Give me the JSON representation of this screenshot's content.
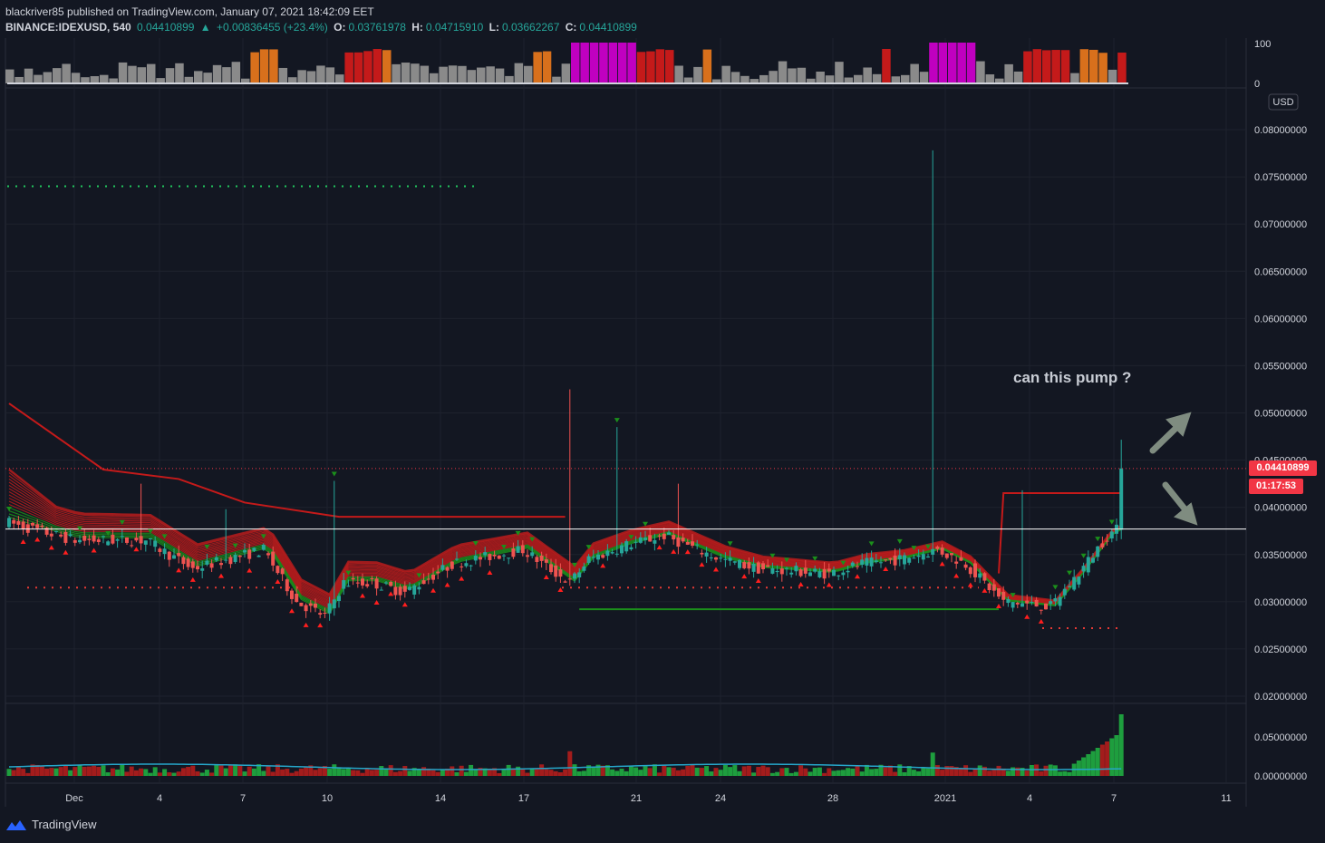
{
  "header": {
    "publisher": "blackriver85 published on TradingView.com, January 07, 2021 18:42:09 EET",
    "symbol": "BINANCE:IDEXUSD, 540",
    "last": "0.04410899",
    "change": "+0.00836455 (+23.4%)",
    "o_label": "O:",
    "o": "0.03761978",
    "h_label": "H:",
    "h": "0.04715910",
    "l_label": "L:",
    "l": "0.03662267",
    "c_label": "C:",
    "c": "0.04410899"
  },
  "price_tag": "0.04410899",
  "countdown": "01:17:53",
  "currency": "USD",
  "annotation": "can this pump ?",
  "footer_brand": "TradingView",
  "colors": {
    "background": "#131722",
    "up": "#26a69a",
    "down": "#ef5350",
    "ribbon_red": "#b71c1c",
    "ribbon_green": "#1b8f1b",
    "magenta": "#c000c0",
    "orange": "#d8701c",
    "dark_red": "#c41a1a",
    "gray": "#8a8a8a",
    "arrow": "#7f8c80"
  },
  "chart_data": {
    "type": "candlestick",
    "price_axis": {
      "ylim": [
        0.0185,
        0.0845
      ],
      "ticks": [
        "0.02000000",
        "0.02500000",
        "0.03000000",
        "0.03500000",
        "0.04000000",
        "0.04500000",
        "0.05000000",
        "0.05500000",
        "0.06000000",
        "0.06500000",
        "0.07000000",
        "0.07500000",
        "0.08000000"
      ]
    },
    "x_axis": {
      "labels": [
        "Dec",
        "4",
        "7",
        "10",
        "14",
        "17",
        "21",
        "24",
        "28",
        "2021",
        "4",
        "7",
        "11"
      ]
    },
    "top_indicator": {
      "ticks": [
        "100",
        "0"
      ],
      "ylim": [
        0,
        100
      ]
    },
    "volume_axis": {
      "ticks": [
        "0.05000000",
        "0.00000000"
      ]
    },
    "horizontal_levels": {
      "white_line": 0.0377,
      "red_dotted_last": 0.04411,
      "green_dotted_top": 0.074
    },
    "last_candle": {
      "o": 0.03761978,
      "h": 0.0471591,
      "l": 0.03662267,
      "c": 0.04410899
    },
    "max_spike_high": 0.0778
  }
}
